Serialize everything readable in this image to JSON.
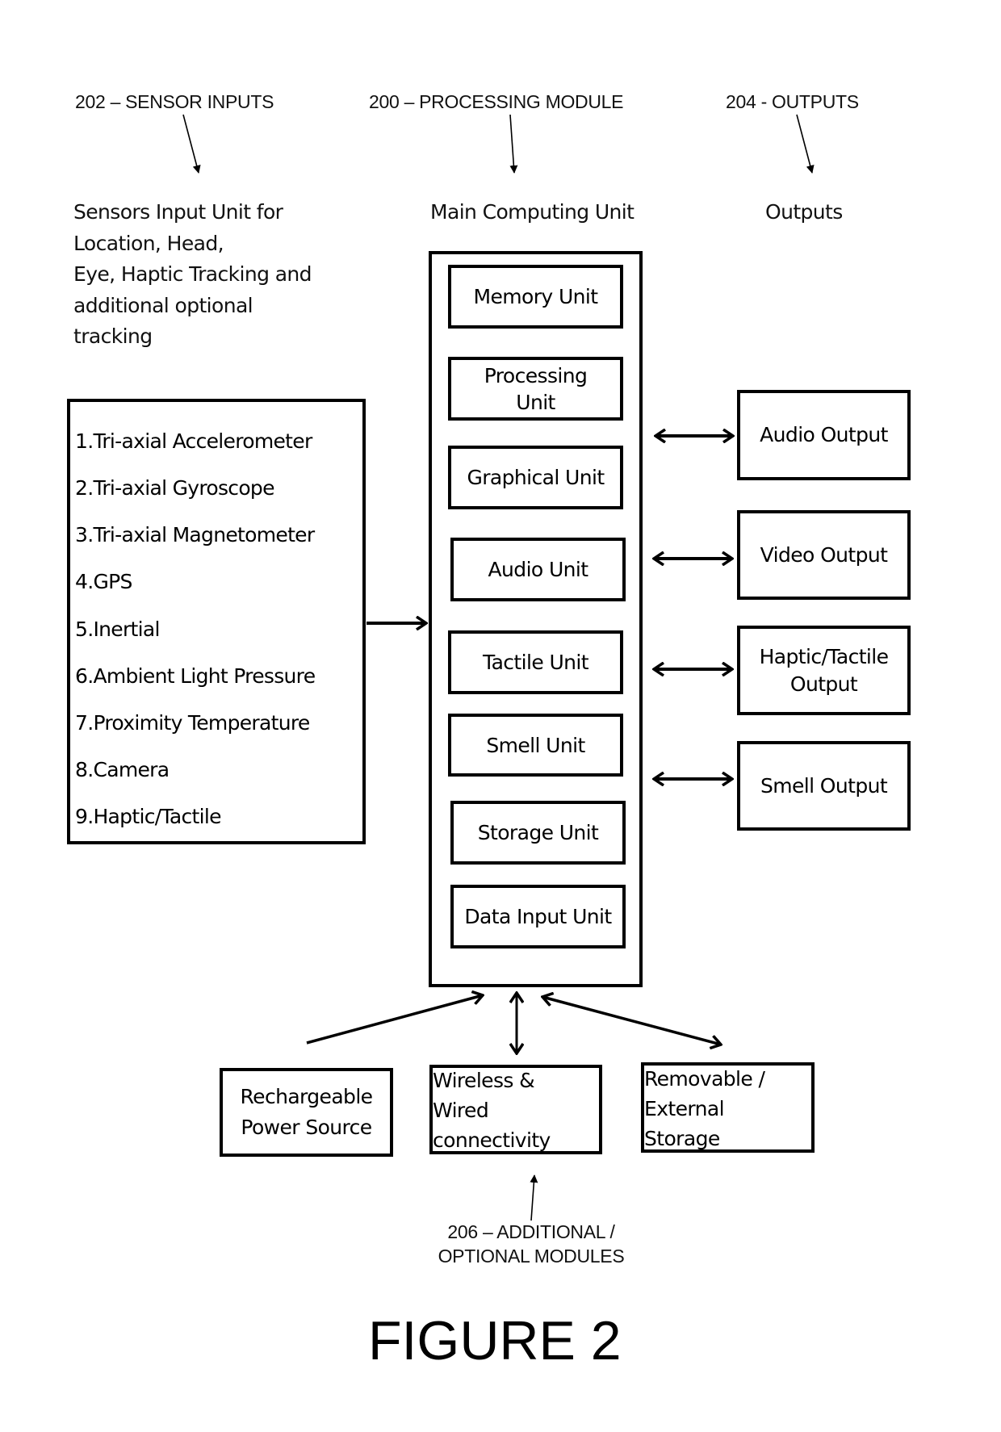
{
  "figure": {
    "title": "FIGURE 2"
  },
  "reference_labels": {
    "sensor_inputs": "202 – SENSOR INPUTS",
    "processing_module": "200 – PROCESSING  MODULE",
    "outputs": "204 - OUTPUTS",
    "optional_modules_line1": "206 – ADDITIONAL /",
    "optional_modules_line2": "OPTIONAL MODULES"
  },
  "headers": {
    "sensor_desc": "Sensors Input Unit for Location, Head, Eye, Haptic Tracking and additional optional tracking",
    "sensor_desc_lines": [
      "Sensors Input Unit for",
      "Location, Head,",
      "Eye, Haptic Tracking and",
      "additional optional",
      "tracking"
    ],
    "main_unit": "Main Computing Unit",
    "outputs": "Outputs"
  },
  "sensors": [
    "1.Tri-axial Accelerometer",
    "2.Tri-axial Gyroscope",
    "3.Tri-axial Magnetometer",
    "4.GPS",
    "5.Inertial",
    "6.Ambient Light Pressure",
    "7.Proximity Temperature",
    "8.Camera",
    "9.Haptic/Tactile"
  ],
  "main_units": [
    [
      "Memory Unit"
    ],
    [
      "Processing",
      "Unit"
    ],
    [
      "Graphical Unit"
    ],
    [
      "Audio Unit"
    ],
    [
      "Tactile Unit"
    ],
    [
      "Smell Unit"
    ],
    [
      "Storage Unit"
    ],
    [
      "Data Input Unit"
    ]
  ],
  "outputs": [
    [
      "Audio Output"
    ],
    [
      "Video Output"
    ],
    [
      "Haptic/Tactile",
      "Output"
    ],
    [
      "Smell Output"
    ]
  ],
  "modules": [
    [
      "Rechargeable",
      "Power Source"
    ],
    [
      "Wireless &",
      "Wired",
      "connectivity"
    ],
    [
      "Removable /",
      "External",
      "Storage"
    ]
  ],
  "connections": [
    {
      "from": "sensors",
      "to": "main_unit",
      "direction": "one-way"
    },
    {
      "from": "main_unit",
      "to": "Audio Output",
      "direction": "two-way"
    },
    {
      "from": "main_unit",
      "to": "Video Output",
      "direction": "two-way"
    },
    {
      "from": "main_unit",
      "to": "Haptic/Tactile Output",
      "direction": "two-way"
    },
    {
      "from": "main_unit",
      "to": "Smell Output",
      "direction": "two-way"
    },
    {
      "from": "Rechargeable Power Source",
      "to": "main_unit",
      "direction": "one-way"
    },
    {
      "from": "main_unit",
      "to": "Wireless & Wired connectivity",
      "direction": "two-way"
    },
    {
      "from": "main_unit",
      "to": "Removable / External Storage",
      "direction": "two-way"
    }
  ]
}
